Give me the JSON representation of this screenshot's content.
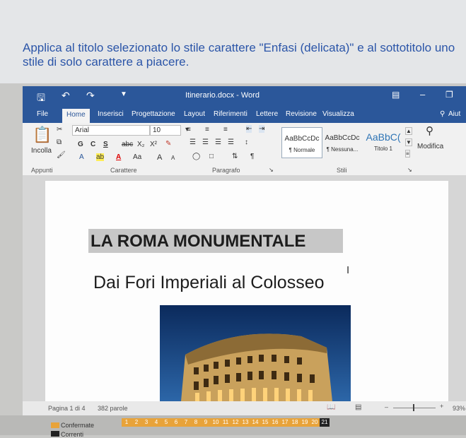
{
  "instruction": "Applica al titolo selezionato lo stile carattere \"Enfasi (delicata)\" e al sottotitolo uno stile di solo carattere a piacere.",
  "window": {
    "title": "Itinerario.docx - Word"
  },
  "tabs": [
    "File",
    "Home",
    "Inserisci",
    "Progettazione",
    "Layout",
    "Riferimenti",
    "Lettere",
    "Revisione",
    "Visualizza"
  ],
  "tell_me": "Aiut",
  "ribbon": {
    "paste_label": "Incolla",
    "font_name": "Arial",
    "font_size": "10",
    "bold": "G",
    "italic": "C",
    "underline": "S",
    "strike": "abc",
    "subscript": "X₂",
    "superscript": "X²",
    "case": "Aa",
    "grow": "A",
    "shrink": "A",
    "groups": {
      "clipboard": "Appunti",
      "font": "Carattere",
      "paragraph": "Paragrafo",
      "styles": "Stili"
    },
    "styles": [
      {
        "preview": "AaBbCcDc",
        "name": "¶ Normale"
      },
      {
        "preview": "AaBbCcDc",
        "name": "¶ Nessuna..."
      },
      {
        "preview": "AaBbC(",
        "name": "Titolo 1"
      }
    ],
    "modify": "Modifica"
  },
  "document": {
    "title": "LA ROMA MONUMENTALE",
    "subtitle": "Dai Fori Imperiali al Colosseo"
  },
  "status": {
    "page": "Pagina 1 di 4",
    "words": "382 parole",
    "zoom": "93%"
  },
  "taskbar": {
    "confirmed": "Confermate",
    "current": "Correnti",
    "numbers": [
      "1",
      "2",
      "3",
      "4",
      "5",
      "6",
      "7",
      "8",
      "9",
      "10",
      "11",
      "12",
      "13",
      "14",
      "15",
      "16",
      "17",
      "18",
      "19",
      "20",
      "21"
    ],
    "current_number": "21"
  }
}
